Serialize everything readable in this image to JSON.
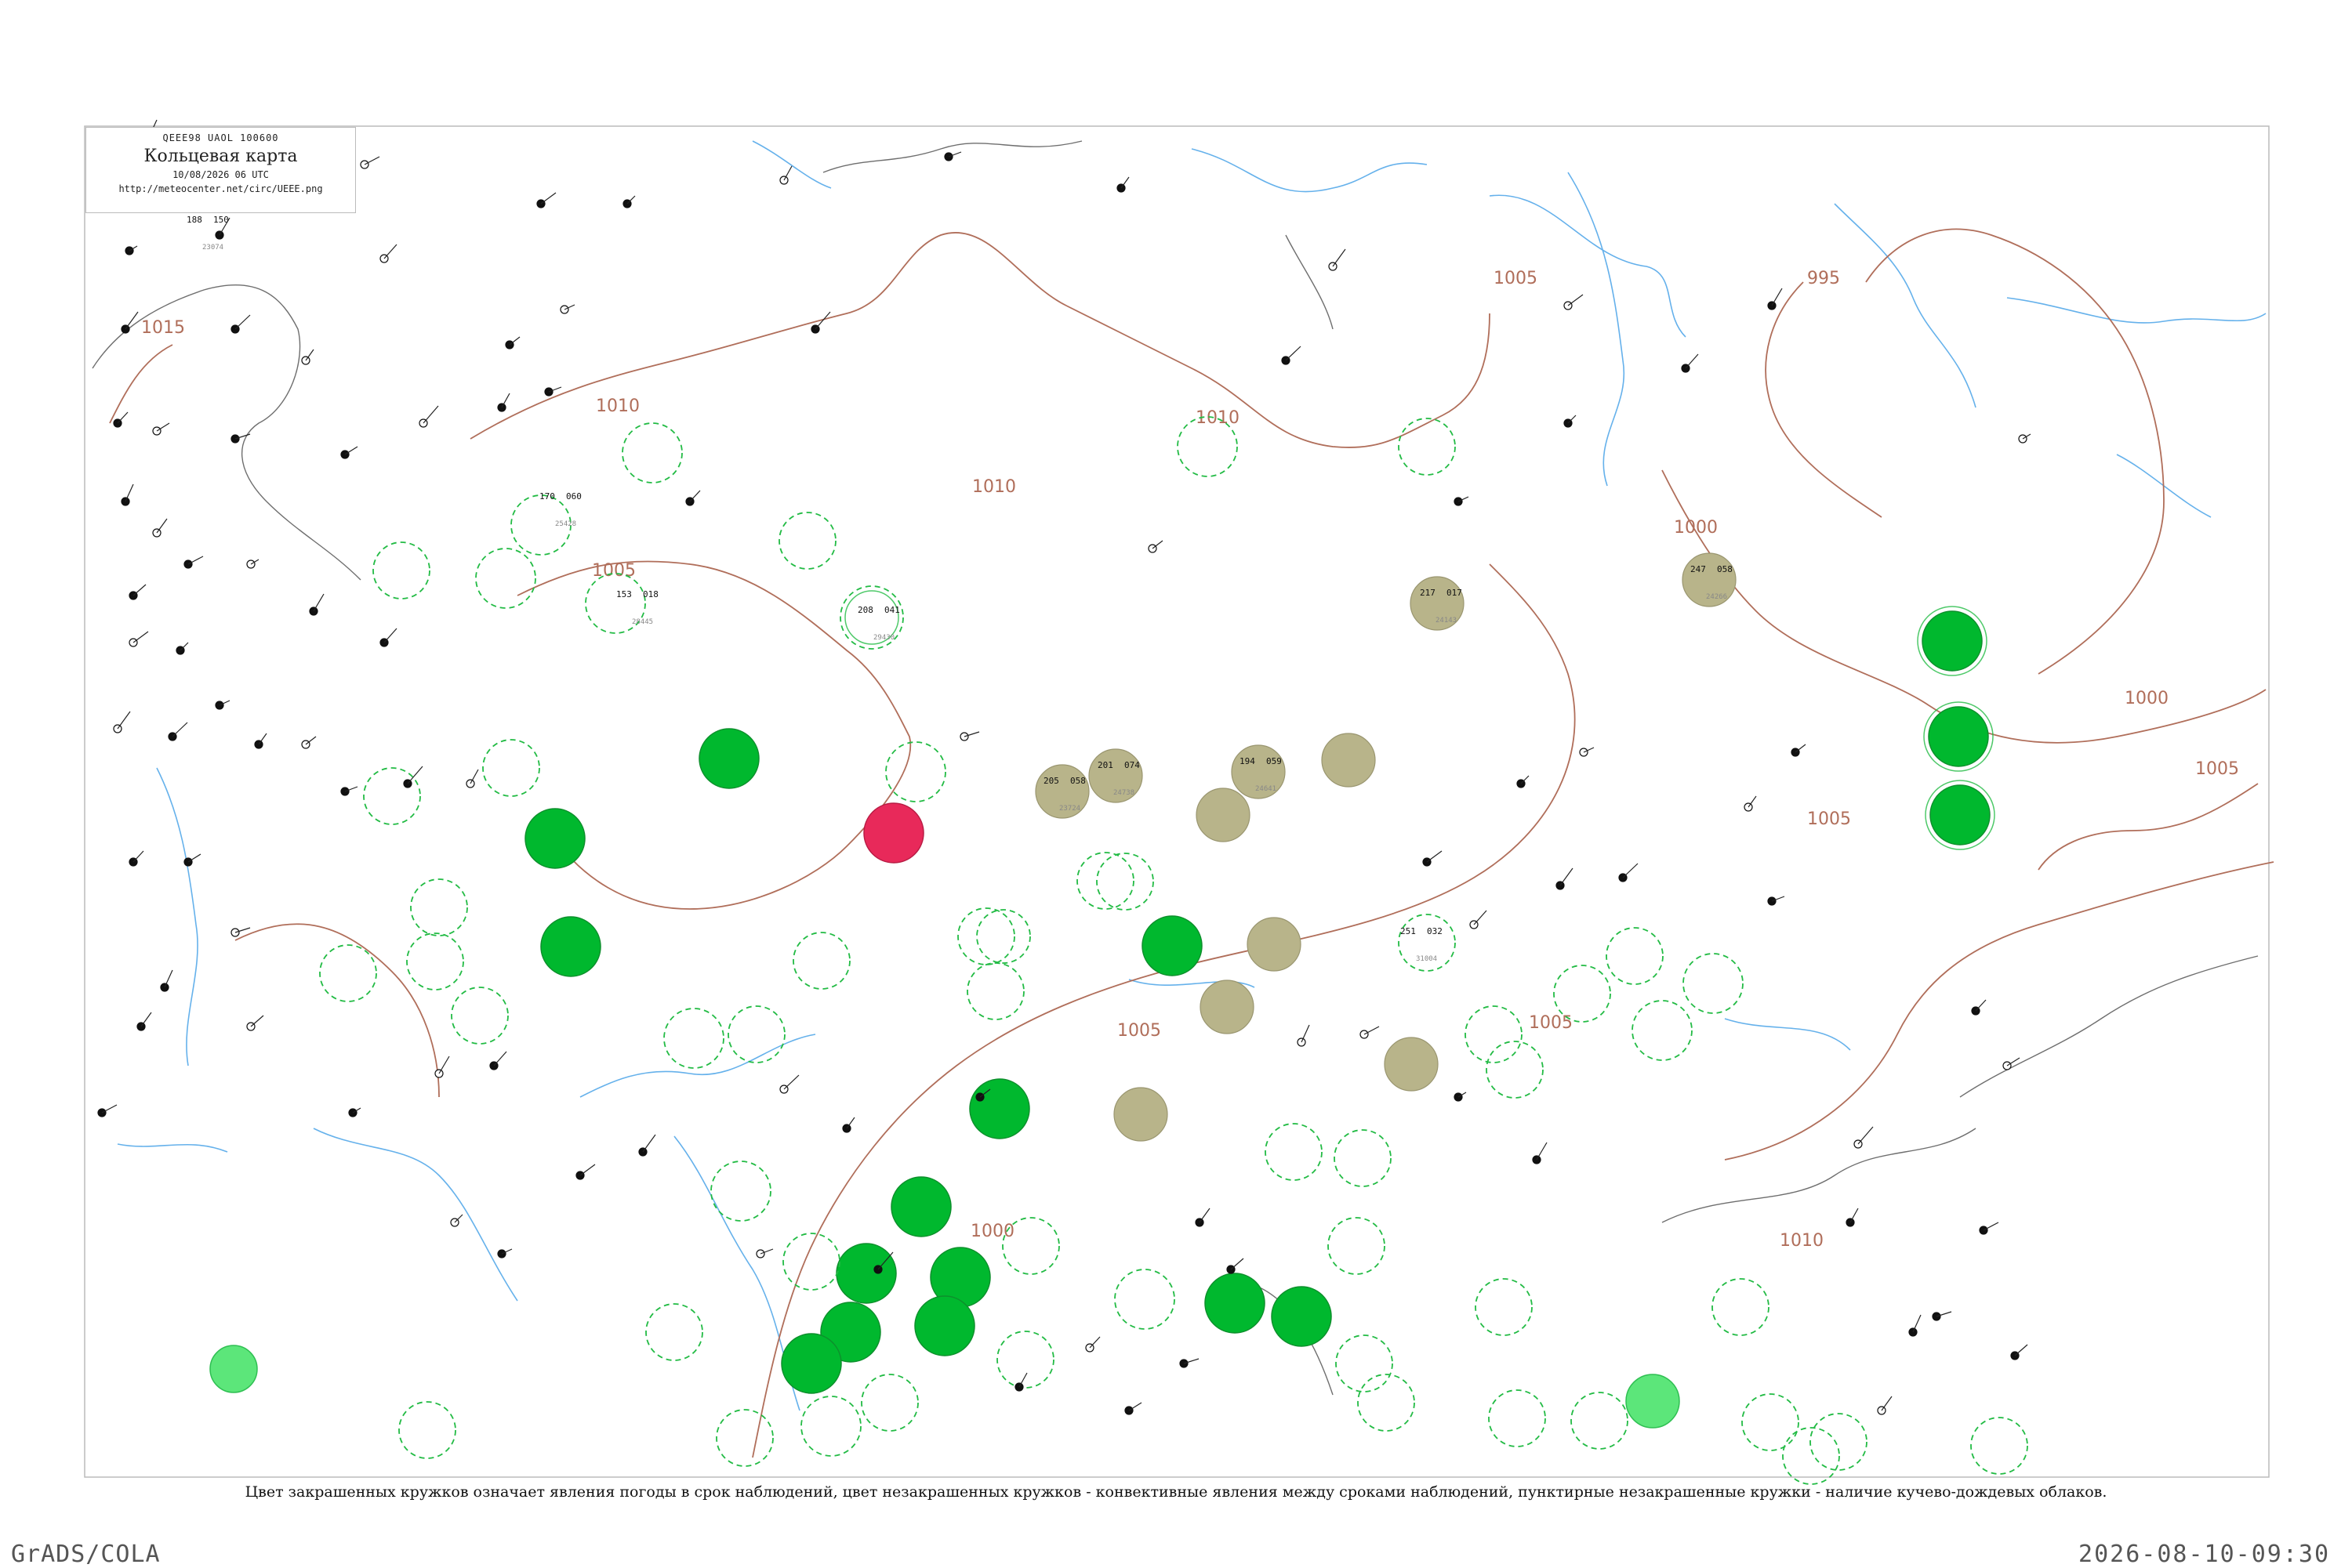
{
  "header": {
    "code": "QEEE98 UAOL 100600",
    "title": "Кольцевая карта",
    "date": "10/08/2026 06 UTC",
    "url": "http://meteocenter.net/circ/UEEE.png"
  },
  "isobars": [
    {
      "label": "1015"
    },
    {
      "label": "1010"
    },
    {
      "label": "1010"
    },
    {
      "label": "1010"
    },
    {
      "label": "1005"
    },
    {
      "label": "1005"
    },
    {
      "label": "1005"
    },
    {
      "label": "1005"
    },
    {
      "label": "1005"
    },
    {
      "label": "1000"
    },
    {
      "label": "1000"
    },
    {
      "label": "995"
    },
    {
      "label": "1010"
    },
    {
      "label": "1005"
    },
    {
      "label": "1000"
    }
  ],
  "colors": {
    "precip": "#00b82e",
    "precip_light": "#5ce67a",
    "fog_haze": "#b8b48a",
    "storm": "#e8295a",
    "convective_ring": "#22bb44",
    "isobar": "#b06e5a",
    "water": "#4aa3e8"
  },
  "stations": [
    {
      "id": "23074",
      "t": "188",
      "p": "150"
    },
    {
      "id": "28445",
      "t": "153",
      "p": "018"
    },
    {
      "id": "29430",
      "t": "208",
      "p": "041"
    },
    {
      "id": "25428",
      "t": "170",
      "p": "060"
    },
    {
      "id": "23724",
      "t": "205",
      "p": "058"
    },
    {
      "id": "24738",
      "t": "201",
      "p": "074"
    },
    {
      "id": "24641",
      "t": "194",
      "p": "059"
    },
    {
      "id": "24143",
      "t": "217",
      "p": "017"
    },
    {
      "id": "24266",
      "t": "247",
      "p": "058"
    },
    {
      "id": "31004",
      "t": "251",
      "p": "032"
    }
  ],
  "caption": "Цвет закрашенных кружков означает явления погоды в срок наблюдений, цвет незакрашенных кружков - конвективные явления между сроками наблюдений, пунктирные незакрашенные кружки - наличие кучево-дождевых облаков.",
  "footer": {
    "left": "GrADS/COLA",
    "right": "2026-08-10-09:30"
  }
}
